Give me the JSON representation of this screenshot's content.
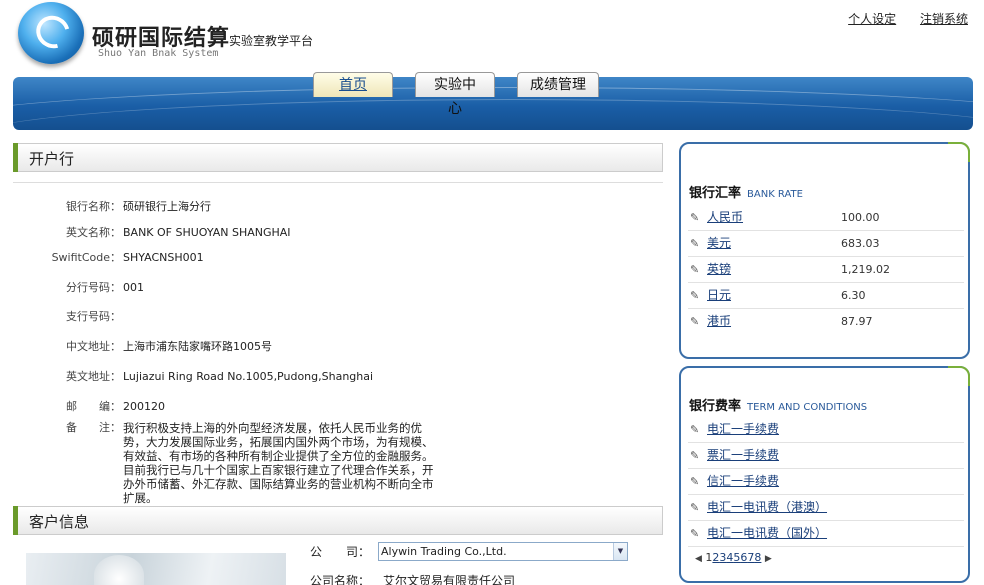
{
  "header": {
    "brand_title": "硕研国际结算",
    "brand_subtitle": "实验室教学平台",
    "brand_en": "Shuo Yan Bnak System",
    "links": {
      "profile": "个人设定",
      "logout": "注销系统"
    }
  },
  "nav": {
    "tabs": [
      {
        "label": "首页",
        "active": true
      },
      {
        "label": "实验中心",
        "active": false
      },
      {
        "label": "成绩管理",
        "active": false
      }
    ]
  },
  "bank": {
    "section_title": "开户行",
    "fields": [
      {
        "label": "银行名称",
        "value": "硕研银行上海分行"
      },
      {
        "label": "英文名称",
        "value": "BANK OF SHUOYAN SHANGHAI"
      },
      {
        "label": "SwifitCode",
        "value": "SHYACNSH001"
      },
      {
        "label": "分行号码",
        "value": "001"
      },
      {
        "label": "支行号码",
        "value": ""
      },
      {
        "label": "中文地址",
        "value": "上海市浦东陆家嘴环路1005号"
      },
      {
        "label": "英文地址",
        "value": "Lujiazui Ring Road No.1005,Pudong,Shanghai"
      },
      {
        "label": "邮　　编",
        "value": "200120"
      },
      {
        "label": "备　　注",
        "value": "我行积极支持上海的外向型经济发展，依托人民币业务的优势，大力发展国际业务，拓展国内国外两个市场，为有规模、有效益、有市场的各种所有制企业提供了全方位的金融服务。目前我行已与几十个国家上百家银行建立了代理合作关系，开办外币储蓄、外汇存款、国际结算业务的营业机构不断向全市扩展。"
      }
    ]
  },
  "customer": {
    "section_title": "客户信息",
    "company_label": "公　　司：",
    "company_selected": "Alywin Trading Co.,Ltd.",
    "company_name_label": "公司名称：",
    "company_name": "艾尔文贸易有限责任公司"
  },
  "rates_panel": {
    "title": "银行汇率",
    "title_en": "BANK RATE",
    "items": [
      {
        "name": "人民币",
        "rate": "100.00"
      },
      {
        "name": "美元",
        "rate": "683.03"
      },
      {
        "name": "英镑",
        "rate": "1,219.02"
      },
      {
        "name": "日元",
        "rate": "6.30"
      },
      {
        "name": "港币",
        "rate": "87.97"
      }
    ]
  },
  "fees_panel": {
    "title": "银行费率",
    "title_en": "TERM AND CONDITIONS",
    "items": [
      {
        "name": "电汇一手续费"
      },
      {
        "name": "票汇一手续费"
      },
      {
        "name": "信汇一手续费"
      },
      {
        "name": "电汇一电讯费（港澳）"
      },
      {
        "name": "电汇一电讯费（国外）"
      }
    ],
    "pager": {
      "pages": [
        "1",
        "2",
        "3",
        "4",
        "5",
        "6",
        "7",
        "8"
      ],
      "current": "1"
    }
  },
  "icons": {
    "pin": "pushpin-icon",
    "dropdown": "chevron-down-icon"
  }
}
